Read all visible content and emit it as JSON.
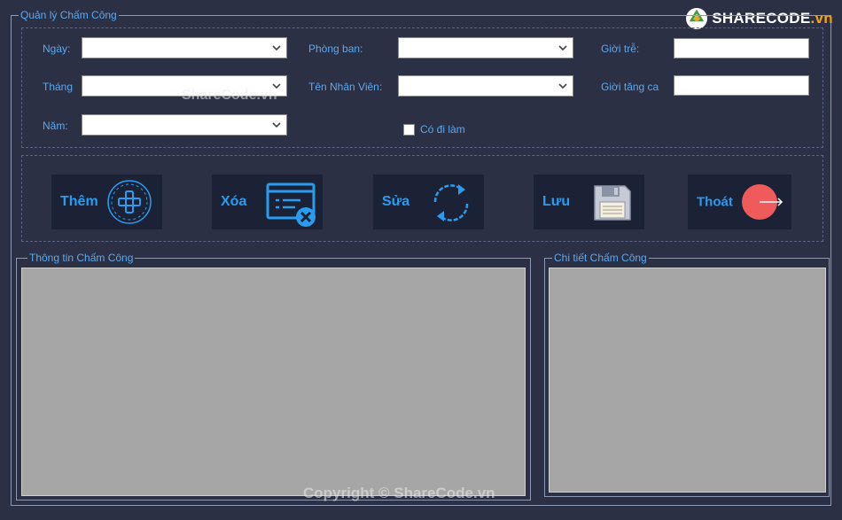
{
  "watermark": {
    "brand_main": "SHARECODE",
    "brand_tld": ".vn",
    "mid_text": "ShareCode.vn",
    "bottom_text": "Copyright © ShareCode.vn"
  },
  "main_group": {
    "title": "Quản lý Chấm Công"
  },
  "fields": {
    "ngay": {
      "label": "Ngày:",
      "value": ""
    },
    "thang": {
      "label": "Tháng",
      "value": ""
    },
    "nam": {
      "label": "Năm:",
      "value": ""
    },
    "phong_ban": {
      "label": "Phòng ban:",
      "value": ""
    },
    "ten_nhan_vien": {
      "label": "Tên Nhân Viên:",
      "value": ""
    },
    "gio_tre": {
      "label": "Giời trễ:",
      "value": ""
    },
    "gio_tang_ca": {
      "label": "Giời tăng ca",
      "value": ""
    },
    "co_di_lam": {
      "label": "Có đi làm",
      "checked": false
    }
  },
  "buttons": {
    "them": {
      "label": "Thêm",
      "icon": "plus-circle-icon",
      "color": "#2a9cf0"
    },
    "xoa": {
      "label": "Xóa",
      "icon": "delete-card-icon",
      "color": "#2a9cf0"
    },
    "sua": {
      "label": "Sửa",
      "icon": "refresh-icon",
      "color": "#2a9cf0"
    },
    "luu": {
      "label": "Lưu",
      "icon": "floppy-disk-icon",
      "color": "#2a9cf0"
    },
    "thoat": {
      "label": "Thoát",
      "icon": "exit-circle-icon",
      "color": "#ef5a5a"
    }
  },
  "panels": {
    "thong_tin": {
      "title": "Thông tin Chấm Công"
    },
    "chi_tiet": {
      "title": "Chi tiết Chấm Công"
    }
  },
  "colors": {
    "background": "#2b3044",
    "label": "#5aa9f0",
    "button_bg": "#1b2236",
    "panel_bg": "#a6a6a6"
  }
}
